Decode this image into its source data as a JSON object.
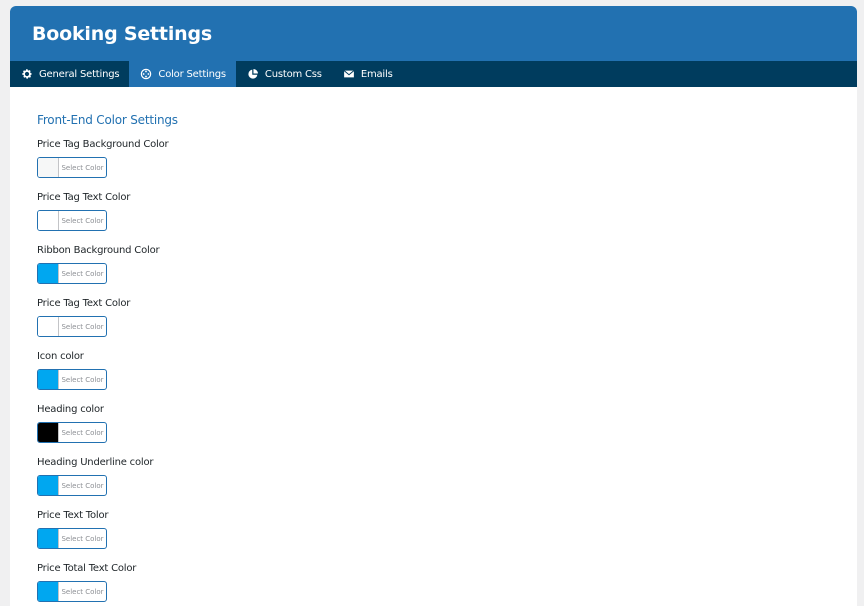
{
  "header": {
    "title": "Booking Settings"
  },
  "tabs": [
    {
      "label": "General Settings",
      "icon": "gear-icon"
    },
    {
      "label": "Color Settings",
      "icon": "palette-icon"
    },
    {
      "label": "Custom Css",
      "icon": "pie-icon"
    },
    {
      "label": "Emails",
      "icon": "envelope-icon"
    }
  ],
  "section": {
    "title": "Front-End Color Settings"
  },
  "picker_label": "Select Color",
  "fields": [
    {
      "label": "Price Tag Background Color",
      "color": "#f6f7f7"
    },
    {
      "label": "Price Tag Text Color",
      "color": "#ffffff"
    },
    {
      "label": "Ribbon Background Color",
      "color": "#00a7f0"
    },
    {
      "label": "Price Tag Text Color",
      "color": "#ffffff"
    },
    {
      "label": "Icon color",
      "color": "#00a7f0"
    },
    {
      "label": "Heading color",
      "color": "#000000"
    },
    {
      "label": "Heading Underline color",
      "color": "#00a7f0"
    },
    {
      "label": "Price Text Tolor",
      "color": "#00a7f0"
    },
    {
      "label": "Price Total Text Color",
      "color": "#00a7f0"
    }
  ]
}
